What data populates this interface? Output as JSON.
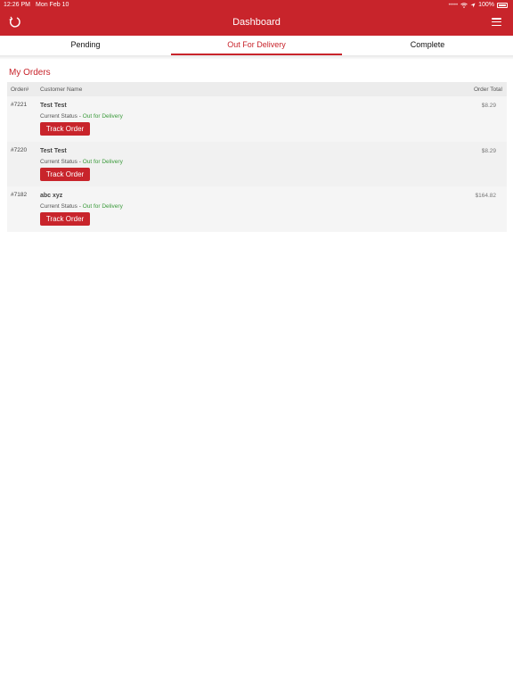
{
  "status_bar": {
    "time": "12:26 PM",
    "date": "Mon Feb 10",
    "signal_dots": "•••••",
    "battery": "100%"
  },
  "header": {
    "title": "Dashboard",
    "refresh_icon": "refresh-icon",
    "menu_icon": "hamburger-menu-icon",
    "bg_color": "#c8242b"
  },
  "tabs": [
    {
      "label": "Pending"
    },
    {
      "label": "Out For Delivery",
      "active": true
    },
    {
      "label": "Complete"
    }
  ],
  "main": {
    "section_title": "My Orders",
    "columns": {
      "order": "Order#",
      "customer": "Customer Name",
      "total": "Order Total"
    },
    "status_prefix": "Current Status - ",
    "orders": [
      {
        "number": "#7221",
        "customer": "Test Test",
        "status": "Out for Delivery",
        "total": "$8.29",
        "button": "Track Order"
      },
      {
        "number": "#7220",
        "customer": "Test Test",
        "status": "Out for Delivery",
        "total": "$8.29",
        "button": "Track Order"
      },
      {
        "number": "#7182",
        "customer": "abc xyz",
        "status": "Out for Delivery",
        "total": "$164.82",
        "button": "Track Order"
      }
    ]
  },
  "colors": {
    "accent": "#c8242b",
    "status_green": "#3a9a3a"
  }
}
